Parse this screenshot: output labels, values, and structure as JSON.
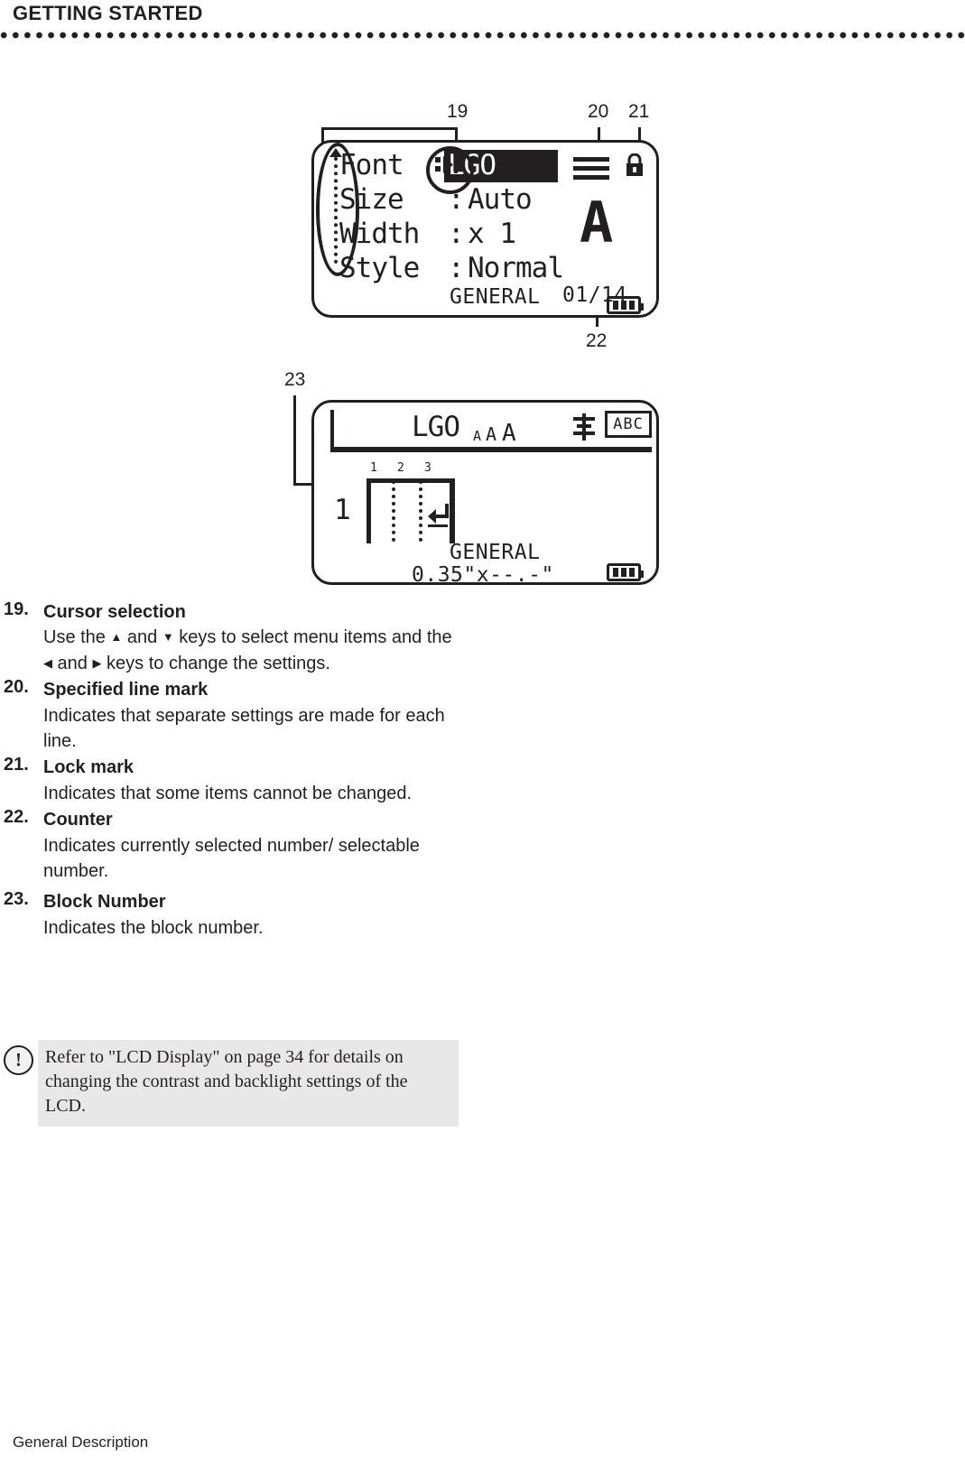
{
  "header": {
    "title": "GETTING STARTED"
  },
  "footer": {
    "text": "General Description"
  },
  "figure": {
    "callouts": [
      {
        "id": "19",
        "label": "19"
      },
      {
        "id": "20",
        "label": "20"
      },
      {
        "id": "21",
        "label": "21"
      },
      {
        "id": "22",
        "label": "22"
      },
      {
        "id": "23",
        "label": "23"
      }
    ],
    "lcd_menu": {
      "rows": [
        {
          "label": "Font",
          "separator": ":",
          "value": "LGO",
          "highlighted": true
        },
        {
          "label": "Size",
          "separator": ":",
          "value": "Auto",
          "highlighted": false
        },
        {
          "label": "Width",
          "separator": ":",
          "value": "x 1",
          "highlighted": false
        },
        {
          "label": "Style",
          "separator": ":",
          "value": "Normal",
          "highlighted": false
        }
      ],
      "tape_label": "GENERAL",
      "counter": "01/14",
      "preview_glyph": "A",
      "icons": {
        "cursor_selection": "cursor-left-right-icon",
        "specified_line_mark": "specified-line-icon",
        "lock_mark": "lock-icon",
        "battery": "battery-icon",
        "scroll_up": "scroll-up-arrow-icon"
      }
    },
    "lcd_text": {
      "status_font": "LGO",
      "size_marks": "AAA",
      "align_icon": "align-center-icon",
      "frame_icon_label": "ABC",
      "block_numbers": [
        "1",
        "2",
        "3"
      ],
      "line_number": "1",
      "return_symbol": "return-arrow-icon",
      "tape_label": "GENERAL",
      "tape_size": "0.35\"x--.-\"",
      "battery": "battery-icon"
    }
  },
  "descriptions": [
    {
      "num": "19.",
      "title": "Cursor selection",
      "body_parts": [
        "Use the ",
        "▲",
        " and ",
        "▼",
        " keys to select menu items and the ",
        "◀",
        " and ",
        "▶",
        " keys to change the settings."
      ],
      "body": "Use the ▲ and ▼ keys to select menu items and the ◀ and ▶ keys to change the settings."
    },
    {
      "num": "20.",
      "title": "Specified line mark",
      "body": "Indicates that separate settings are made for each line."
    },
    {
      "num": "21.",
      "title": "Lock mark",
      "body": "Indicates that some items cannot be changed."
    },
    {
      "num": "22.",
      "title": "Counter",
      "body": "Indicates currently selected number/ selectable number."
    },
    {
      "num": "23.",
      "title": "Block Number",
      "body": "Indicates the block number."
    }
  ],
  "note": {
    "icon": "exclamation-icon",
    "icon_glyph": "!",
    "text": "Refer to \"LCD Display\" on page 34 for details on changing the contrast and backlight settings of the LCD."
  },
  "colors": {
    "ink": "#231f20",
    "note_bg": "#e8e8e8",
    "page_bg": "#ffffff"
  }
}
